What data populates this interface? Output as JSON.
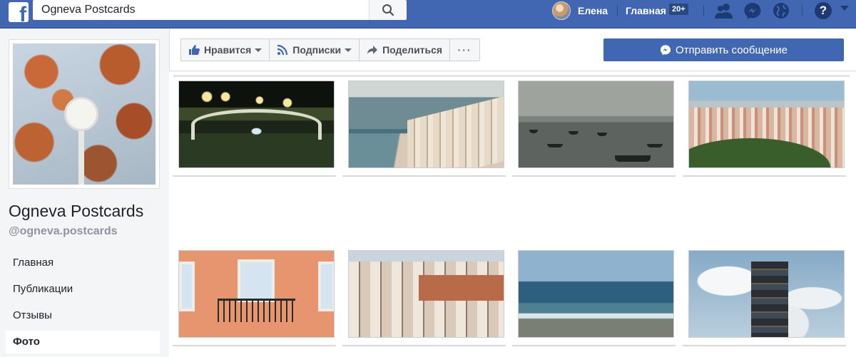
{
  "topbar": {
    "logo": "f",
    "search_value": "Ogneva Postcards",
    "profile_name": "Елена",
    "home_label": "Главная",
    "home_badge": "20+",
    "icons": [
      "friend-requests-icon",
      "messenger-icon",
      "globe-notifications-icon",
      "help-icon"
    ],
    "help_label": "?"
  },
  "page": {
    "name": "Ogneva Postcards",
    "handle": "@ogneva.postcards"
  },
  "nav": {
    "items": [
      {
        "label": "Главная",
        "active": false
      },
      {
        "label": "Публикации",
        "active": false
      },
      {
        "label": "Отзывы",
        "active": false
      },
      {
        "label": "Фото",
        "active": true
      }
    ]
  },
  "actions": {
    "like_label": "Нравится",
    "follow_label": "Подписки",
    "share_label": "Поделиться",
    "more_label": "···",
    "message_label": "Отправить сообщение"
  },
  "photos": [
    {
      "subject": "night bridge with lights"
    },
    {
      "subject": "coastal town and sea"
    },
    {
      "subject": "boats on grey water"
    },
    {
      "subject": "city rooftops panorama"
    },
    {
      "subject": "balcony with flowers"
    },
    {
      "subject": "city buildings from above"
    },
    {
      "subject": "sea waves on beach"
    },
    {
      "subject": "tower building under clouds"
    }
  ],
  "colors": {
    "brand": "#4267b2",
    "page_bg": "#f4f5f7"
  }
}
